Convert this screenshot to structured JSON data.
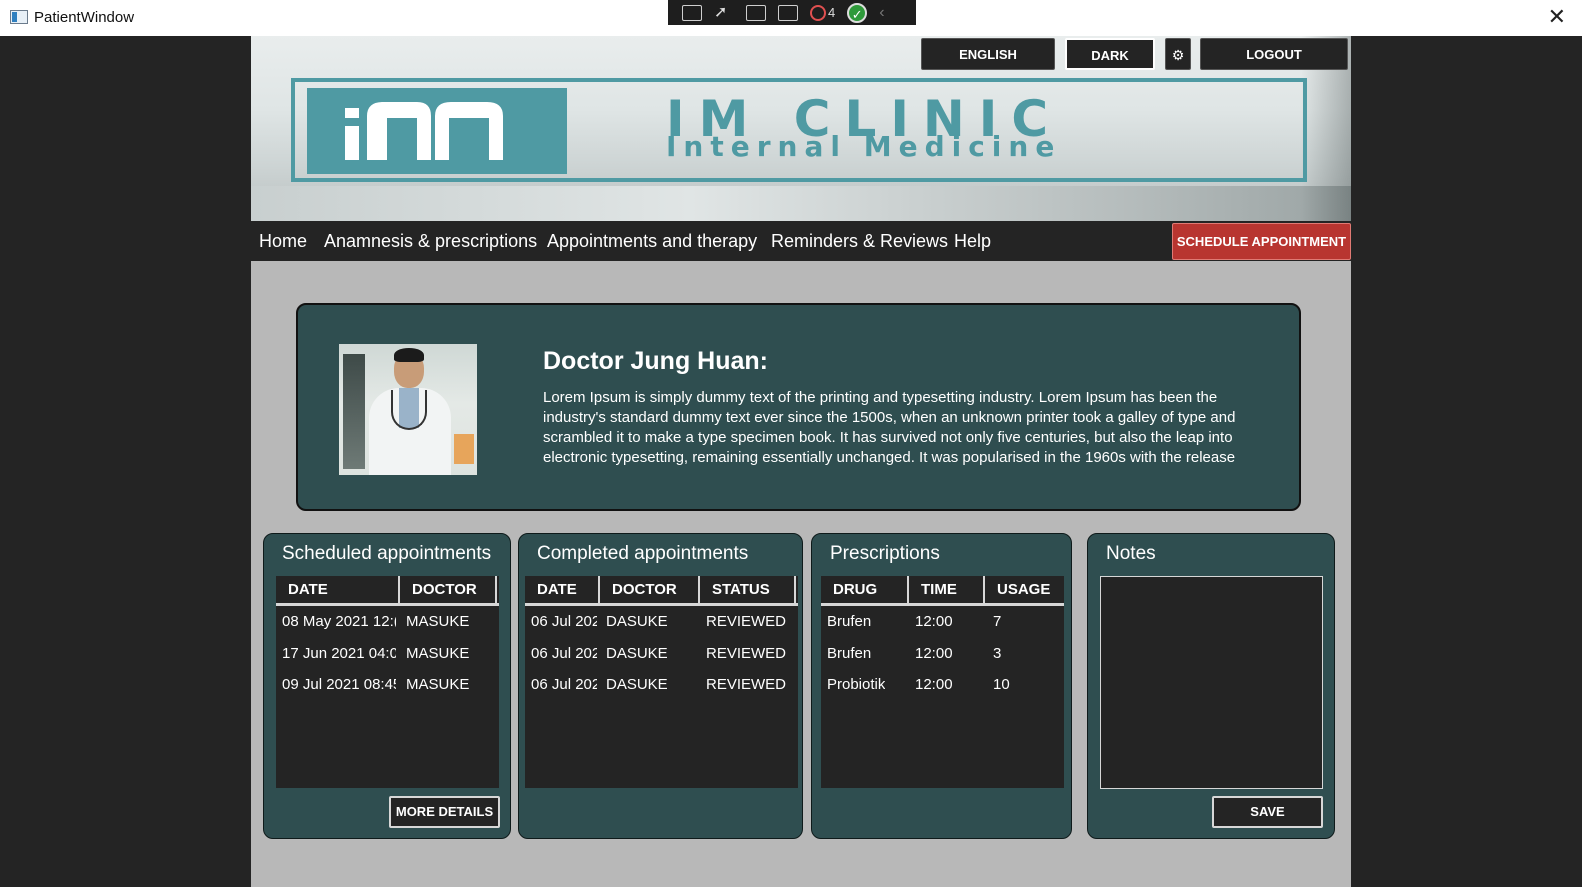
{
  "window": {
    "title": "PatientWindow",
    "close_glyph": "✕"
  },
  "debug_toolbar": {
    "error_count": "4",
    "check_glyph": "✓",
    "collapse_glyph": "‹"
  },
  "banner": {
    "title": "IM CLINIC",
    "subtitle": "Internal Medicine",
    "accent_color": "#4f9aa3"
  },
  "top_buttons": {
    "language": "ENGLISH",
    "theme": "DARK",
    "settings_icon": "gear-icon",
    "settings_glyph": "⚙",
    "logout": "LOGOUT"
  },
  "nav": {
    "items": [
      "Home",
      "Anamnesis & prescriptions",
      "Appointments and therapy",
      "Reminders & Reviews",
      "Help"
    ],
    "schedule_label": "SCHEDULE APPOINTMENT"
  },
  "doctor": {
    "name": "Doctor Jung Huan:",
    "bio": "Lorem Ipsum is simply dummy text of the printing and typesetting industry. Lorem Ipsum has been the industry's standard dummy text ever since the 1500s, when an unknown printer took a galley of type and scrambled it to make a type specimen book. It has survived not only five centuries, but also the leap into electronic typesetting, remaining essentially unchanged. It was popularised in the 1960s with the release"
  },
  "scheduled": {
    "title": "Scheduled appointments",
    "columns": [
      "DATE",
      "DOCTOR"
    ],
    "rows": [
      [
        "08 May 2021 12:(",
        "MASUKE"
      ],
      [
        "17 Jun 2021 04:0(",
        "MASUKE"
      ],
      [
        "09 Jul 2021 08:45",
        "MASUKE"
      ]
    ],
    "button": "MORE DETAILS"
  },
  "completed": {
    "title": "Completed appointments",
    "columns": [
      "DATE",
      "DOCTOR",
      "STATUS"
    ],
    "rows": [
      [
        "06 Jul 202",
        "DASUKE",
        "REVIEWED"
      ],
      [
        "06 Jul 202",
        "DASUKE",
        "REVIEWED"
      ],
      [
        "06 Jul 202",
        "DASUKE",
        "REVIEWED"
      ]
    ]
  },
  "prescriptions": {
    "title": "Prescriptions",
    "columns": [
      "DRUG",
      "TIME",
      "USAGE"
    ],
    "rows": [
      [
        "Brufen",
        "12:00",
        "7"
      ],
      [
        "Brufen",
        "12:00",
        "3"
      ],
      [
        "Probiotik",
        "12:00",
        "10"
      ]
    ]
  },
  "notes": {
    "title": "Notes",
    "value": "",
    "button": "SAVE"
  },
  "colors": {
    "panel": "#2f4e50",
    "dark": "#242424",
    "schedule_button": "#b83530",
    "content_bg": "#b8b8b8"
  }
}
